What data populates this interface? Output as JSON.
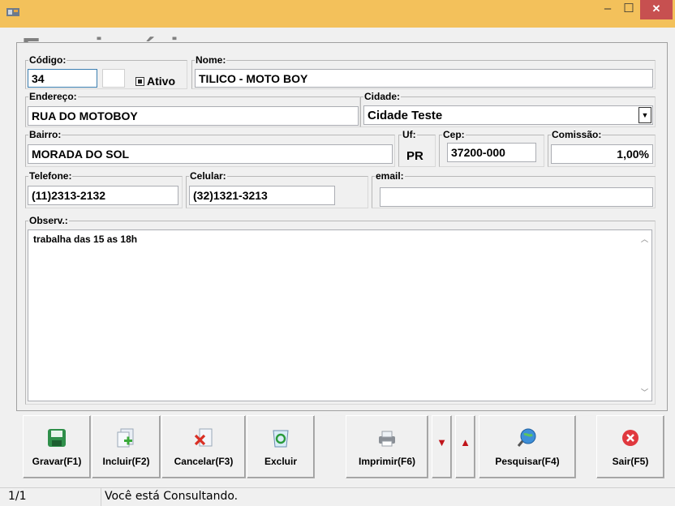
{
  "form": {
    "title": "Funcionário"
  },
  "fields": {
    "codigo": {
      "label": "Código:",
      "value": "34"
    },
    "ativo": {
      "label": "Ativo",
      "checked": true
    },
    "nome": {
      "label": "Nome:",
      "value": "TILICO - MOTO BOY"
    },
    "endereco": {
      "label": "Endereço:",
      "value": "RUA DO MOTOBOY"
    },
    "cidade": {
      "label": "Cidade:",
      "value": "Cidade Teste"
    },
    "bairro": {
      "label": "Bairro:",
      "value": "MORADA DO SOL"
    },
    "uf": {
      "label": "Uf:",
      "value": "PR"
    },
    "cep": {
      "label": "Cep:",
      "value": "37200-000"
    },
    "comissao": {
      "label": "Comissão:",
      "value": "1,00%"
    },
    "telefone": {
      "label": "Telefone:",
      "value": "(11)2313-2132"
    },
    "celular": {
      "label": "Celular:",
      "value": "(32)1321-3213"
    },
    "email": {
      "label": "email:",
      "value": ""
    },
    "observ": {
      "label": "Observ.:",
      "value": "trabalha das 15 as 18h"
    }
  },
  "toolbar": {
    "gravar": "Gravar(F1)",
    "incluir": "Incluir(F2)",
    "cancelar": "Cancelar(F3)",
    "excluir": "Excluir",
    "imprimir": "Imprimir(F6)",
    "pesquisar": "Pesquisar(F4)",
    "sair": "Sair(F5)"
  },
  "status": {
    "record": "1/1",
    "message": "Você está Consultando."
  },
  "icons": {
    "app": "app-icon",
    "minimize": "minimize-icon",
    "maximize": "maximize-icon",
    "close": "close-icon",
    "gravar": "floppy-disk-icon",
    "incluir": "new-document-icon",
    "cancelar": "cancel-document-icon",
    "excluir": "recycle-bin-icon",
    "imprimir": "printer-icon",
    "down": "arrow-down-icon",
    "up": "arrow-up-icon",
    "pesquisar": "magnifier-globe-icon",
    "sair": "exit-icon"
  },
  "colors": {
    "titlebar": "#f3c15b",
    "close_button": "#c75050",
    "form_title": "#808080"
  }
}
